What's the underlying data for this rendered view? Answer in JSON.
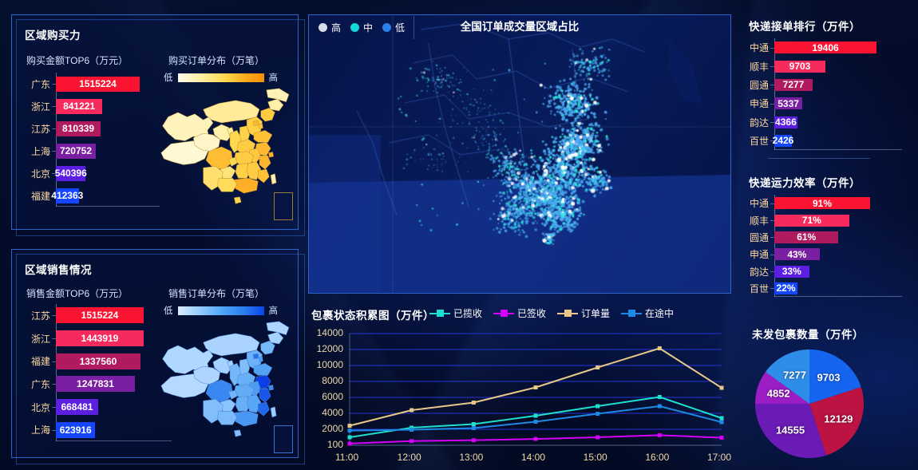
{
  "theme": {
    "bg": "#040b2e",
    "panel_border": "#2f63c8",
    "title_color": "#ffffff",
    "category_color": "#ffd9a0",
    "axis_color": "#f0d9a8"
  },
  "purchase_panel": {
    "title": "区域购买力",
    "bar_title": "购买金额TOP6（万元）",
    "map_title": "购买订单分布（万笔）",
    "legend_low": "低",
    "legend_high": "高",
    "chart_data": {
      "type": "bar",
      "title": "购买金额TOP6（万元）",
      "orientation": "horizontal",
      "categories": [
        "广东",
        "浙江",
        "江苏",
        "上海",
        "北京",
        "福建"
      ],
      "values": [
        1515224,
        841221,
        810339,
        720752,
        540396,
        412363
      ],
      "labels": [
        "1515224",
        "841221",
        "810339",
        "720752",
        "540396",
        "412363"
      ],
      "colors": [
        "#fa1432",
        "#f72a5e",
        "#b01a5e",
        "#7b1fa2",
        "#5c1ee0",
        "#1546ff"
      ],
      "xlabel": "",
      "ylabel": ""
    }
  },
  "sales_panel": {
    "title": "区域销售情况",
    "bar_title": "销售金额TOP6（万元）",
    "map_title": "销售订单分布（万笔）",
    "legend_low": "低",
    "legend_high": "高",
    "chart_data": {
      "type": "bar",
      "title": "销售金额TOP6（万元）",
      "orientation": "horizontal",
      "categories": [
        "江苏",
        "浙江",
        "福建",
        "广东",
        "北京",
        "上海"
      ],
      "values": [
        1515224,
        1443919,
        1337560,
        1247831,
        668481,
        623916
      ],
      "labels": [
        "1515224",
        "1443919",
        "1337560",
        "1247831",
        "668481",
        "623916"
      ],
      "colors": [
        "#fa1432",
        "#f72a5e",
        "#b01a5e",
        "#7b1fa2",
        "#5c1ee0",
        "#1546ff"
      ],
      "xlabel": "",
      "ylabel": ""
    }
  },
  "center_map": {
    "title": "全国订单成交量区域占比",
    "legend": [
      {
        "label": "高",
        "color": "#d8dce6"
      },
      {
        "label": "中",
        "color": "#12d8d8"
      },
      {
        "label": "低",
        "color": "#2b7fe8"
      }
    ]
  },
  "courier_orders": {
    "title": "快递接单排行（万件）",
    "chart_data": {
      "type": "bar",
      "title": "快递接单排行（万件）",
      "orientation": "horizontal",
      "categories": [
        "中通",
        "顺丰",
        "圆通",
        "申通",
        "韵达",
        "百世"
      ],
      "values": [
        19406,
        9703,
        7277,
        5337,
        4366,
        2426
      ],
      "labels": [
        "19406",
        "9703",
        "7277",
        "5337",
        "4366",
        "2426"
      ],
      "colors": [
        "#fa1432",
        "#f72a5e",
        "#b01a5e",
        "#7b1fa2",
        "#5c1ee0",
        "#1546ff"
      ],
      "xlabel": "",
      "ylabel": ""
    }
  },
  "courier_efficiency": {
    "title": "快递运力效率（万件）",
    "chart_data": {
      "type": "bar",
      "title": "快递运力效率（万件）",
      "orientation": "horizontal",
      "categories": [
        "中通",
        "顺丰",
        "圆通",
        "申通",
        "韵达",
        "百世"
      ],
      "values": [
        91,
        71,
        61,
        43,
        33,
        22
      ],
      "labels": [
        "91%",
        "71%",
        "61%",
        "43%",
        "33%",
        "22%"
      ],
      "unit": "%",
      "colors": [
        "#fa1432",
        "#f72a5e",
        "#b01a5e",
        "#7b1fa2",
        "#5c1ee0",
        "#1546ff"
      ],
      "xlabel": "",
      "ylabel": ""
    }
  },
  "unshipped_pie": {
    "title": "未发包裹数量（万件）",
    "chart_data": {
      "type": "pie",
      "title": "未发包裹数量（万件）",
      "labels": [
        "9703",
        "12129",
        "14555",
        "4852",
        "7277"
      ],
      "values": [
        9703,
        12129,
        14555,
        4852,
        7277
      ],
      "colors": [
        "#1565f0",
        "#bb1342",
        "#6a1bb5",
        "#9b1ec4",
        "#2f8dea"
      ],
      "legend": "none"
    }
  },
  "package_status": {
    "title": "包裹状态积累图（万件）",
    "chart_data": {
      "type": "line",
      "title": "包裹状态积累图（万件）",
      "x": [
        "11:00",
        "12:00",
        "13:00",
        "14:00",
        "15:00",
        "16:00",
        "17:00"
      ],
      "xlabel": "",
      "ylabel": "",
      "ylim": [
        100,
        14000
      ],
      "yticks": [
        100,
        2000,
        4000,
        6000,
        8000,
        10000,
        12000,
        14000
      ],
      "grid": true,
      "legend_position": "top",
      "series": [
        {
          "name": "已揽收",
          "color": "#1ddfce",
          "values": [
            1050,
            2200,
            2650,
            3700,
            4900,
            6050,
            3400
          ]
        },
        {
          "name": "已签收",
          "color": "#d500f9",
          "values": [
            300,
            600,
            700,
            850,
            1050,
            1300,
            1000
          ]
        },
        {
          "name": "订单量",
          "color": "#e8c88a",
          "values": [
            2450,
            4400,
            5350,
            7250,
            9750,
            12150,
            7200
          ]
        },
        {
          "name": "在途中",
          "color": "#1e88e5",
          "values": [
            1850,
            1950,
            2150,
            2950,
            3950,
            4900,
            2900
          ]
        }
      ]
    }
  }
}
